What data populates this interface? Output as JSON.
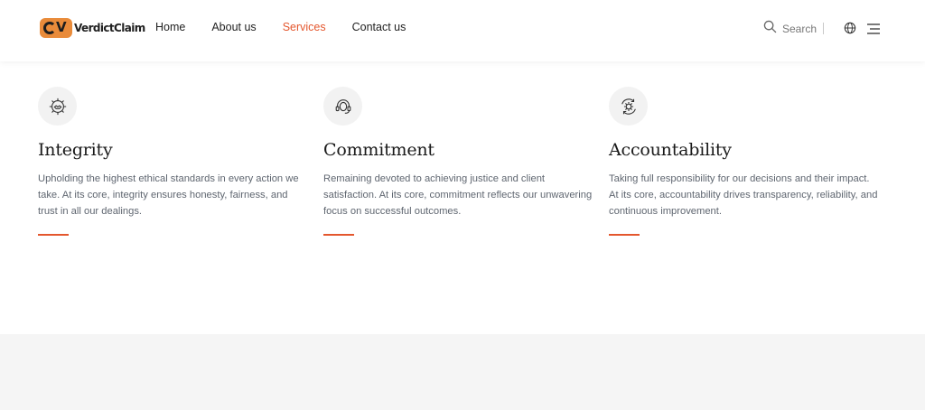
{
  "brand": {
    "badge_letter": "V",
    "name": "VerdictClaim"
  },
  "nav": {
    "items": [
      {
        "label": "Home",
        "active": false
      },
      {
        "label": "About us",
        "active": false
      },
      {
        "label": "Services",
        "active": true
      },
      {
        "label": "Contact us",
        "active": false
      }
    ]
  },
  "header": {
    "search_label": "Search",
    "icons": [
      "search-icon",
      "globe-icon",
      "menu-icon"
    ]
  },
  "colors": {
    "accent": "#e4572e",
    "logo": "#e98b3a",
    "text": "#5f6670",
    "band": "#f5f5f5"
  },
  "values": [
    {
      "icon": "handshake-gear-icon",
      "title": "Integrity",
      "text": "Upholding the highest ethical standards in every action we take. At its core, integrity ensures honesty, fairness, and trust in all our dealings."
    },
    {
      "icon": "headset-icon",
      "title": "Commitment",
      "text": "Remaining devoted to achieving justice and client satisfaction. At its core, commitment reflects our unwavering focus on successful outcomes."
    },
    {
      "icon": "gear-cycle-icon",
      "title": "Accountability",
      "text": "Taking full responsibility for our decisions and their impact. At its core, accountability drives transparency, reliability, and continuous improvement."
    }
  ]
}
